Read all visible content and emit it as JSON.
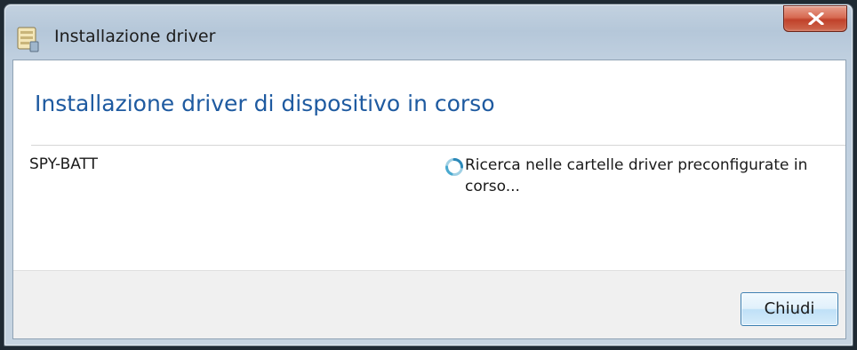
{
  "window": {
    "title": "Installazione driver",
    "close_icon": "close-icon",
    "app_icon": "driver-install-icon"
  },
  "main": {
    "heading": "Installazione driver di dispositivo in corso",
    "device": {
      "name": "SPY-BATT",
      "status_icon": "busy-spinner-icon",
      "status": "Ricerca nelle cartelle driver preconfigurate in corso..."
    }
  },
  "footer": {
    "close_label": "Chiudi"
  },
  "colors": {
    "heading": "#1e5aa0",
    "close_button_red": "#c0412a",
    "button_border": "#3c7fb1"
  }
}
